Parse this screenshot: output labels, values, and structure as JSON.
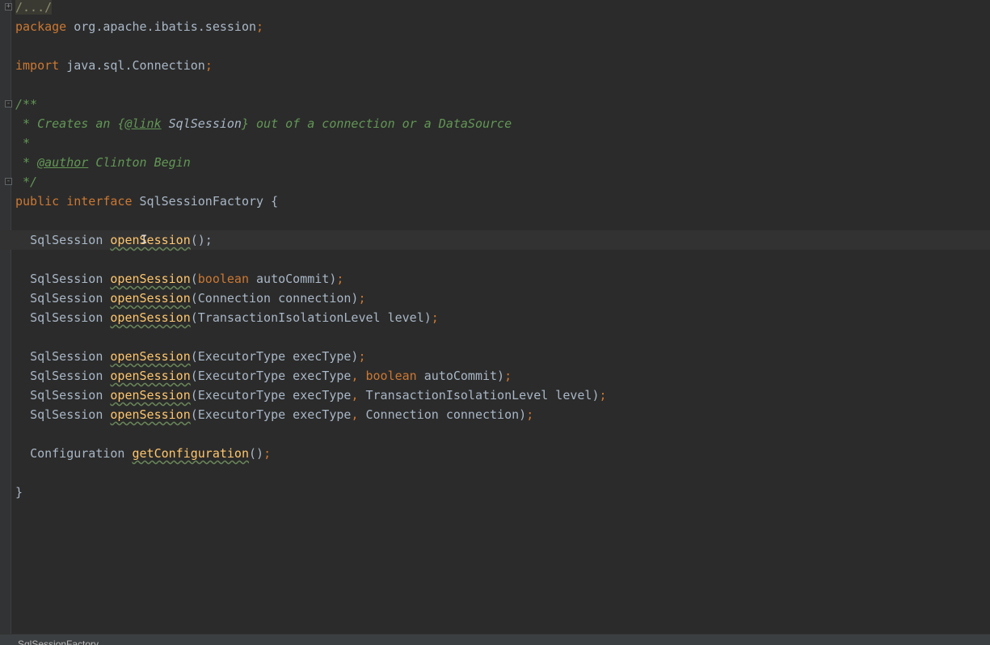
{
  "editor": {
    "fold_label": "/.../",
    "package_kw": "package",
    "package_name": "org.apache.ibatis.session",
    "import_kw": "import",
    "import_name": "java.sql.Connection",
    "doc": {
      "open": "/**",
      "l1_prefix": " * Creates an ",
      "l1_brace_open": "{",
      "l1_link_tag": "@link",
      "l1_ref": " SqlSession",
      "l1_brace_close": "}",
      "l1_suffix": " out of a connection or a DataSource",
      "blank": " *",
      "author_prefix": " * ",
      "author_tag": "@author",
      "author_name": " Clinton Begin",
      "close": " */"
    },
    "decl": {
      "public": "public",
      "interface": "interface",
      "name": "SqlSessionFactory",
      "brace": "{"
    },
    "methods": [
      {
        "ret": "SqlSession",
        "name": "openSession",
        "args": "();"
      },
      {
        "ret": "SqlSession",
        "name": "openSession",
        "args": "(boolean autoCommit);"
      },
      {
        "ret": "SqlSession",
        "name": "openSession",
        "args": "(Connection connection);"
      },
      {
        "ret": "SqlSession",
        "name": "openSession",
        "args": "(TransactionIsolationLevel level);"
      },
      {
        "ret": "SqlSession",
        "name": "openSession",
        "args": "(ExecutorType execType);"
      },
      {
        "ret": "SqlSession",
        "name": "openSession",
        "args": "(ExecutorType execType, boolean autoCommit);"
      },
      {
        "ret": "SqlSession",
        "name": "openSession",
        "args": "(ExecutorType execType, TransactionIsolationLevel level);"
      },
      {
        "ret": "SqlSession",
        "name": "openSession",
        "args": "(ExecutorType execType, Connection connection);"
      },
      {
        "ret": "Configuration",
        "name": "getConfiguration",
        "args": "();"
      }
    ],
    "close_brace": "}"
  },
  "statusbar": {
    "breadcrumb": "SqlSessionFactory"
  },
  "colors": {
    "background": "#2b2b2b",
    "keyword": "#cc7832",
    "comment": "#629755",
    "method": "#ffc66d",
    "text": "#a9b7c6"
  }
}
